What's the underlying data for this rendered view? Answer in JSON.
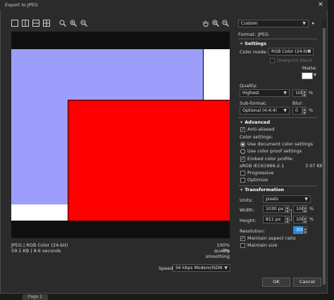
{
  "window": {
    "title": "Export to JPEG",
    "close_glyph": "✕"
  },
  "toolbar": {
    "view_icons": [
      "single-view-icon",
      "split-vertical-icon",
      "split-horizontal-icon",
      "quad-view-icon"
    ],
    "zoom_icons": [
      "zoom-fit-icon",
      "zoom-in-icon",
      "zoom-out-icon"
    ],
    "right_icons": [
      "pan-hand-icon",
      "zoom-in-icon",
      "zoom-out-icon"
    ]
  },
  "preview_info": {
    "format_line": "JPEG  |  RGB Color (24-bit)",
    "size_line": "59.1 KB  |  8.6 seconds",
    "quality_line": "100% quality",
    "smoothing_line": "0% smoothing"
  },
  "speed": {
    "label": "Speed:",
    "value": "56 kbps Modem/ISDN"
  },
  "preset": {
    "value": "Custom"
  },
  "format": {
    "label": "Format:",
    "value": "JPEG"
  },
  "settings": {
    "header": "Settings",
    "color_mode_label": "Color mode:",
    "color_mode_value": "RGB Color (24-bit)",
    "overprint_label": "Overprint black",
    "matte_label": "Matte:",
    "matte_color": "#ffffff",
    "quality_label": "Quality:",
    "quality_value": "Highest",
    "quality_number": "100",
    "percent": "%",
    "subformat_label": "Sub-format:",
    "subformat_value": "Optional (4:4:4)",
    "blur_label": "Blur:",
    "blur_value": "0"
  },
  "advanced": {
    "header": "Advanced",
    "anti_aliased": "Anti-aliased",
    "color_settings_label": "Color settings:",
    "use_document": "Use document color settings",
    "use_proof": "Use color proof settings",
    "embed_profile": "Embed color profile:",
    "profile_name": "sRGB IEC61966-2.1",
    "profile_size": "3.07 KB",
    "progressive": "Progressive",
    "optimize": "Optimize"
  },
  "transformation": {
    "header": "Transformation",
    "units_label": "Units:",
    "units_value": "pixels",
    "width_label": "Width:",
    "width_value": "1030 px",
    "width_pct": "100",
    "height_label": "Height:",
    "height_value": "811 px",
    "height_pct": "100",
    "resolution_label": "Resolution:",
    "resolution_value": "300",
    "maintain_ratio": "Maintain aspect ratio",
    "maintain_size": "Maintain size"
  },
  "buttons": {
    "ok": "OK",
    "cancel": "Cancel"
  },
  "taskbar": {
    "tab_label": "Page 1"
  },
  "colors": {
    "preview_blue": "#9d9dfc",
    "preview_red": "#ff0000",
    "accent": "#2e8bd8"
  }
}
